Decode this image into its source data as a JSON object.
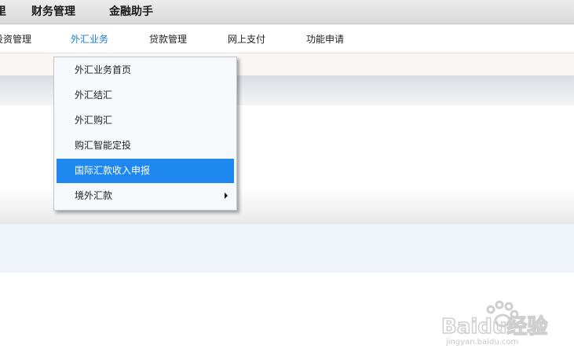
{
  "top_nav": {
    "partial_item": "里",
    "items": [
      "财务管理",
      "金融助手"
    ]
  },
  "sub_nav": {
    "items": [
      {
        "label": "投资管理"
      },
      {
        "label": "外汇业务",
        "active": true
      },
      {
        "label": "贷款管理"
      },
      {
        "label": "网上支付"
      },
      {
        "label": "功能申请"
      }
    ]
  },
  "dropdown": {
    "items": [
      {
        "label": "外汇业务首页"
      },
      {
        "label": "外汇结汇"
      },
      {
        "label": "外汇购汇"
      },
      {
        "label": "购汇智能定投"
      },
      {
        "label": "国际汇款收入申报",
        "highlighted": true
      },
      {
        "label": "境外汇款",
        "has_submenu": true
      }
    ]
  },
  "watermark": {
    "logo_text": "Baidu经验",
    "url": "jingyan.baidu.com"
  },
  "colors": {
    "active_nav": "#1a78d8",
    "highlight": "#1e88f0"
  }
}
